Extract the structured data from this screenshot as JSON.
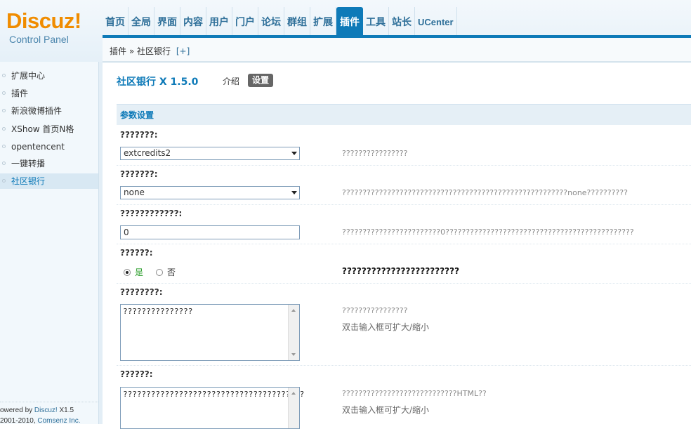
{
  "header": {
    "logo_word": "Discuz!",
    "logo_sub": "Control Panel",
    "nav": [
      {
        "label": "首页"
      },
      {
        "label": "全局"
      },
      {
        "label": "界面"
      },
      {
        "label": "内容"
      },
      {
        "label": "用户"
      },
      {
        "label": "门户"
      },
      {
        "label": "论坛"
      },
      {
        "label": "群组"
      },
      {
        "label": "扩展"
      },
      {
        "label": "插件",
        "active": true
      },
      {
        "label": "工具"
      },
      {
        "label": "站长"
      },
      {
        "label": "UCenter"
      }
    ],
    "breadcrumb": {
      "root": "插件",
      "sep": "»",
      "current": "社区银行",
      "add": "[+]"
    }
  },
  "sidebar": {
    "items": [
      {
        "label": "扩展中心"
      },
      {
        "label": "插件"
      },
      {
        "label": "新浪微博插件"
      },
      {
        "label": "XShow 首页N格"
      },
      {
        "label": "opentencent"
      },
      {
        "label": "一键转播"
      },
      {
        "label": "社区银行",
        "active": true
      }
    ],
    "footer": {
      "line1_prefix": "owered by ",
      "line1_brand": "Discuz!",
      "line1_version": " X1.5",
      "line2_years": "2001-2010, ",
      "line2_company": "Comsenz Inc."
    }
  },
  "main": {
    "title": "社区银行  X 1.5.0",
    "tab_intro": "介绍",
    "tab_settings": "设置",
    "section_title": "参数设置",
    "rows": [
      {
        "label": "???????:",
        "type": "select",
        "value": "extcredits2",
        "comment": "????????????????"
      },
      {
        "label": "???????:",
        "type": "select",
        "value": "none",
        "comment": "???????????????????????????????????????????????????????none??????????"
      },
      {
        "label": "????????????:",
        "type": "text",
        "value": "0",
        "comment": "????????????????????????0??????????????????????????????????????????????"
      },
      {
        "label": "??????:",
        "type": "radio",
        "options": [
          "是",
          "否"
        ],
        "selected": "是",
        "comment": "????????????????????????"
      },
      {
        "label": "????????:",
        "type": "textarea",
        "value": "???????????????",
        "comment": "????????????????",
        "comment2": "双击输入框可扩大/缩小"
      },
      {
        "label": "??????:",
        "type": "textarea",
        "value": "???????????????????????????????????????",
        "comment": "????????????????????????????HTML??",
        "comment2": "双击输入框可扩大/缩小"
      }
    ]
  },
  "colors": {
    "accent": "#0e7ab8",
    "logo_orange": "#f08c00",
    "yes_green": "#2a9d2a"
  }
}
